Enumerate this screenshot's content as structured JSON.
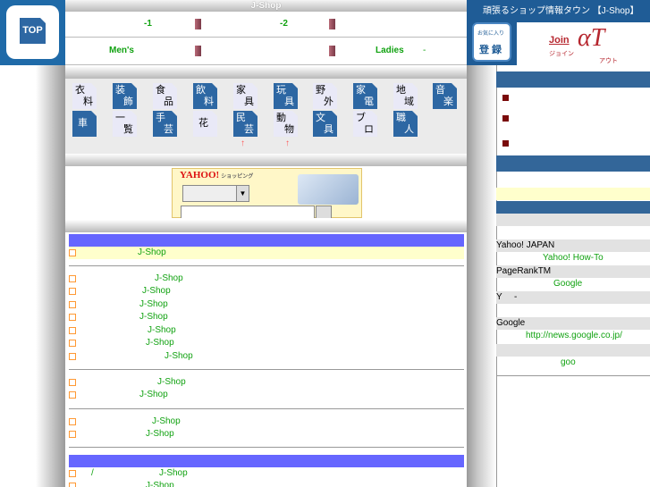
{
  "header": {
    "title": "J-Shop",
    "top_button": "TOP",
    "row1": [
      "-1",
      "-2"
    ],
    "row2": {
      "mens": "Men's",
      "ladies": "Ladies",
      "dash": "-"
    }
  },
  "right_header": {
    "title": "頑張るショップ情報タウン 【J-Shop】",
    "favorite_small": "お気に入り",
    "favorite": "登 録",
    "join": "Join",
    "join_sub": "ジョイン",
    "at": "αT",
    "out_sub": "アウト"
  },
  "categories": [
    {
      "a": "衣",
      "b": "料"
    },
    {
      "a": "装",
      "b": "飾"
    },
    {
      "a": "食",
      "b": "品"
    },
    {
      "a": "飲",
      "b": "料"
    },
    {
      "a": "家",
      "b": "具"
    },
    {
      "a": "玩",
      "b": "具"
    },
    {
      "a": "野",
      "b": "外"
    },
    {
      "a": "家",
      "b": "電"
    },
    {
      "a": "地",
      "b": "域"
    },
    {
      "a": "音",
      "b": "楽"
    },
    {
      "one": "車"
    },
    {
      "a": "一",
      "b": "覧"
    },
    {
      "a": "手",
      "b": "芸"
    },
    {
      "one": "花"
    },
    {
      "a": "民",
      "b": "芸"
    },
    {
      "a": "動",
      "b": "物"
    },
    {
      "a": "文",
      "b": "具"
    },
    {
      "a": "ブ",
      "b": "ロ"
    },
    {
      "a": "職",
      "b": "人"
    }
  ],
  "arrow": "↑",
  "yahoo": {
    "logo": "YAHOO!",
    "logo_sub": "ショッピング"
  },
  "news": {
    "top": "J-Shop",
    "group1": [
      "J-Shop",
      "J-Shop",
      "J-Shop",
      "J-Shop",
      "J-Shop",
      "J-Shop",
      "J-Shop"
    ],
    "group2": [
      "J-Shop",
      "J-Shop"
    ],
    "group3": [
      "J-Shop",
      "J-Shop"
    ],
    "bottom": [
      "J-Shop",
      "J-Shop"
    ],
    "slash": "/"
  },
  "right": {
    "yahoo_japan": "Yahoo! JAPAN",
    "yahoo_howto": "Yahoo! How-To",
    "pagerank": "PageRankTM",
    "google": "Google",
    "y": "Y",
    "dash": "-",
    "google2": "Google",
    "google_news": "http://news.google.co.jp/",
    "goo": "goo"
  }
}
